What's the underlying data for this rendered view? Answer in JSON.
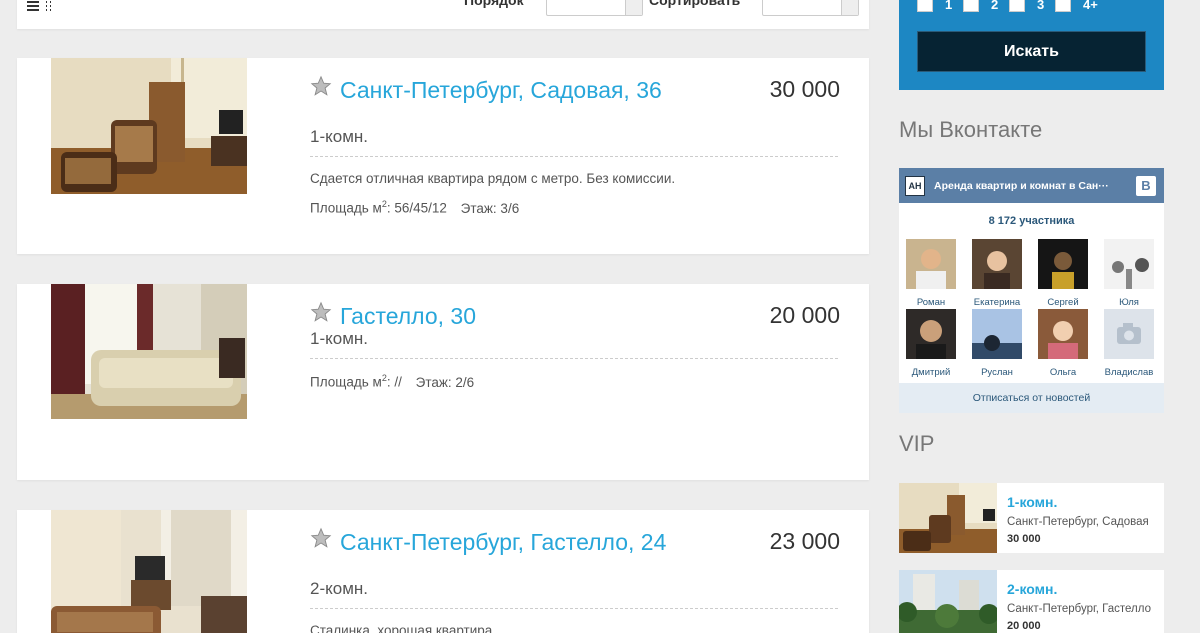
{
  "toolbar": {
    "order_label": "Порядок",
    "sort_label": "Сортировать"
  },
  "listings": [
    {
      "title": "Санкт-Петербург, Садовая, 36",
      "rooms": "1-комн.",
      "price": "30 000",
      "description": "Сдается отличная квартира рядом с метро. Без комиссии.",
      "area_label": "Площадь м",
      "area_sup": "2",
      "area_value": ": 56/45/12",
      "floor": "Этаж: 3/6"
    },
    {
      "title": "Гастелло, 30",
      "rooms": "1-комн.",
      "price": "20 000",
      "description": "",
      "area_label": "Площадь м",
      "area_sup": "2",
      "area_value": ": //",
      "floor": "Этаж: 2/6"
    },
    {
      "title": "Санкт-Петербург, Гастелло, 24",
      "rooms": "2-комн.",
      "price": "23 000",
      "description": "Сталинка, хорошая квартира",
      "area_label": "",
      "area_sup": "",
      "area_value": "",
      "floor": ""
    }
  ],
  "search": {
    "room_options": [
      "1",
      "2",
      "3",
      "4+"
    ],
    "button_label": "Искать"
  },
  "vk": {
    "heading": "Мы Вконтакте",
    "group_name": "Аренда квартир и комнат в Сан···",
    "logo_text": "АН",
    "badge": "В",
    "members_count": "8 172 участника",
    "members": [
      "Роман",
      "Екатерина",
      "Сергей",
      "Юля",
      "Дмитрий",
      "Руслан",
      "Ольга",
      "Владислав"
    ],
    "unsubscribe": "Отписаться от новостей"
  },
  "vip": {
    "heading": "VIP",
    "items": [
      {
        "rooms": "1-комн.",
        "address": "Санкт-Петербург, Садовая",
        "price": "30 000"
      },
      {
        "rooms": "2-комн.",
        "address": "Санкт-Петербург, Гастелло",
        "price": "20 000"
      }
    ]
  },
  "colors": {
    "link_blue": "#27a6da",
    "search_panel": "#1d87c3",
    "vk_header": "#5b7fa6"
  },
  "icons": [
    "list-view-icon",
    "grid-view-icon",
    "favorite-star-icon",
    "camera-icon"
  ]
}
